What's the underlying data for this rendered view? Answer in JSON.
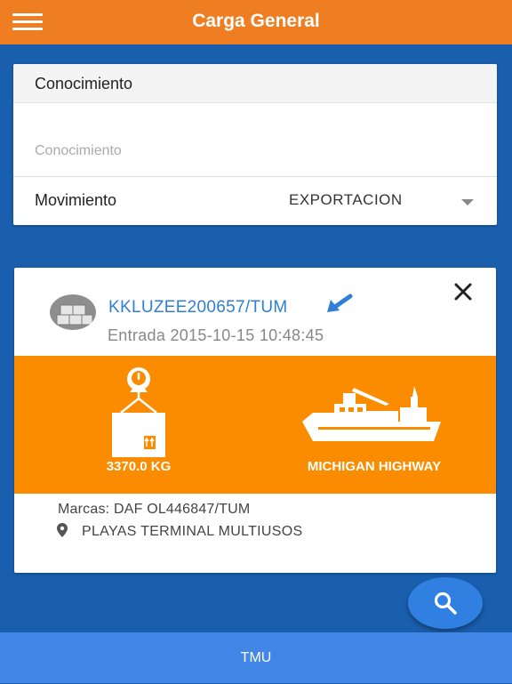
{
  "header": {
    "title": "Carga General",
    "menu_icon": "hamburger-menu-icon",
    "color": "#ef7d22"
  },
  "search_form": {
    "section_title": "Conocimiento",
    "conocimiento_placeholder": "Conocimiento",
    "conocimiento_value": "",
    "movimiento_label": "Movimiento",
    "movimiento_value": "EXPORTACION"
  },
  "result": {
    "code": "KKLUZEE200657/TUM",
    "entrada": "Entrada 2015-10-15 10:48:45",
    "weight": "3370.0 KG",
    "vessel": "MICHIGAN HIGHWAY",
    "marcas": "Marcas: DAF OL446847/TUM",
    "location": "PLAYAS TERMINAL MULTIUSOS",
    "highlight_color": "#fb8c00",
    "link_color": "#2f7fd6"
  },
  "fab": {
    "icon": "search-icon"
  },
  "footer": {
    "label": "TMU"
  },
  "colors": {
    "background": "#1a5fae",
    "footer": "#4287e8"
  }
}
